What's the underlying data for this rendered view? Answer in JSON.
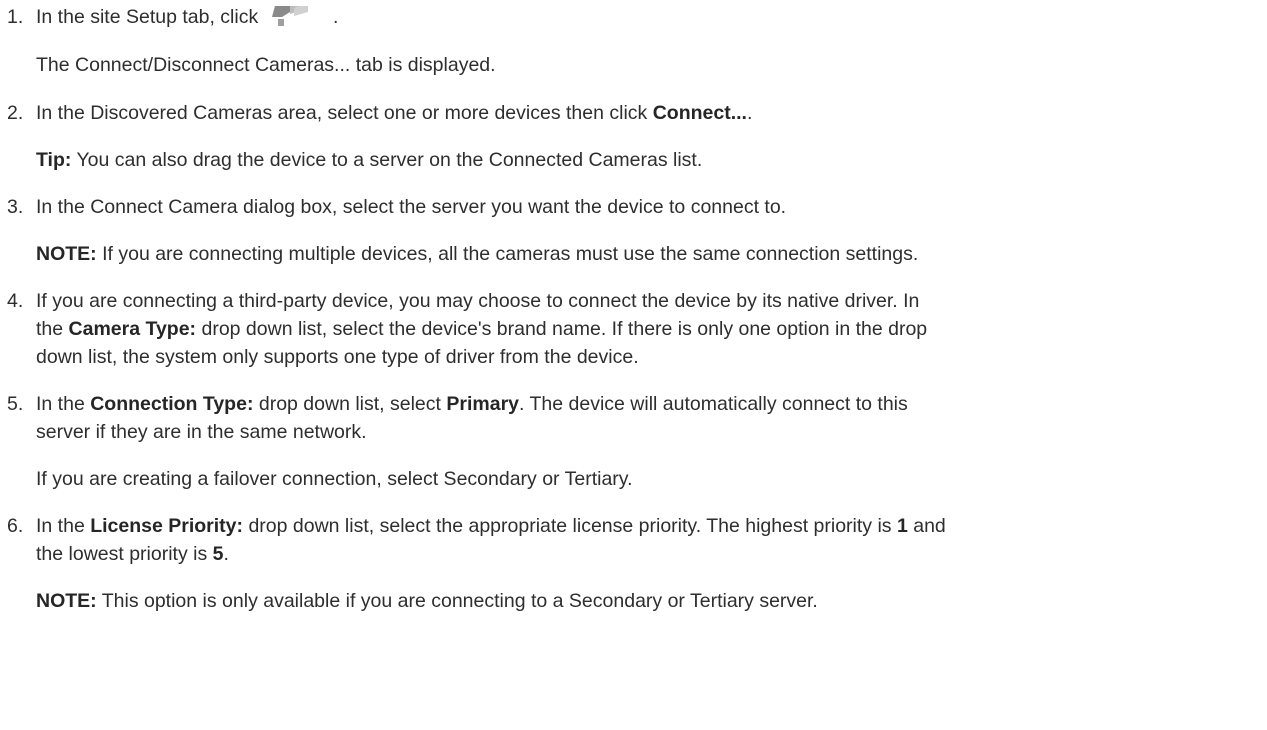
{
  "steps": [
    {
      "number": "1.",
      "text_before_icon": "In the site Setup tab, click",
      "text_after_icon": ".",
      "icon": "connect-cameras-icon",
      "result": "The Connect/Disconnect Cameras... tab is displayed."
    },
    {
      "number": "2.",
      "text_pre": "In the Discovered Cameras area, select one or more devices then click ",
      "text_bold": "Connect...",
      "text_post": ".",
      "tip_label": "Tip:",
      "tip_text": " You can also drag the device to a server on the Connected Cameras list."
    },
    {
      "number": "3.",
      "text": "In the Connect Camera dialog box, select the server you want the device to connect to.",
      "note_label": "NOTE:",
      "note_text": " If you are connecting multiple devices, all the cameras must use the same connection settings."
    },
    {
      "number": "4.",
      "line1": "If you are connecting a third-party device, you may choose to connect the device by its native driver. In",
      "line2_pre": "the ",
      "line2_bold": "Camera Type:",
      "line2_post": " drop down list, select the device's brand name. If there is only one option in the drop",
      "line3": "down list, the system only supports one type of driver from the device."
    },
    {
      "number": "5.",
      "line1_pre": "In the ",
      "line1_bold1": "Connection Type:",
      "line1_mid": " drop down list, select ",
      "line1_bold2": "Primary",
      "line1_post": ". The device will automatically connect to this",
      "line2": "server if they are in the same network.",
      "extra": "If you are creating a failover connection, select Secondary or Tertiary."
    },
    {
      "number": "6.",
      "line1_pre": "In the ",
      "line1_bold": "License Priority:",
      "line1_mid": " drop down list, select the appropriate license priority. The highest priority is ",
      "line1_bold2": "1",
      "line1_post": " and",
      "line2_pre": "the lowest priority is ",
      "line2_bold": "5",
      "line2_post": ".",
      "note_label": "NOTE:",
      "note_text": " This option is only available if you are connecting to a Secondary or Tertiary server."
    }
  ]
}
